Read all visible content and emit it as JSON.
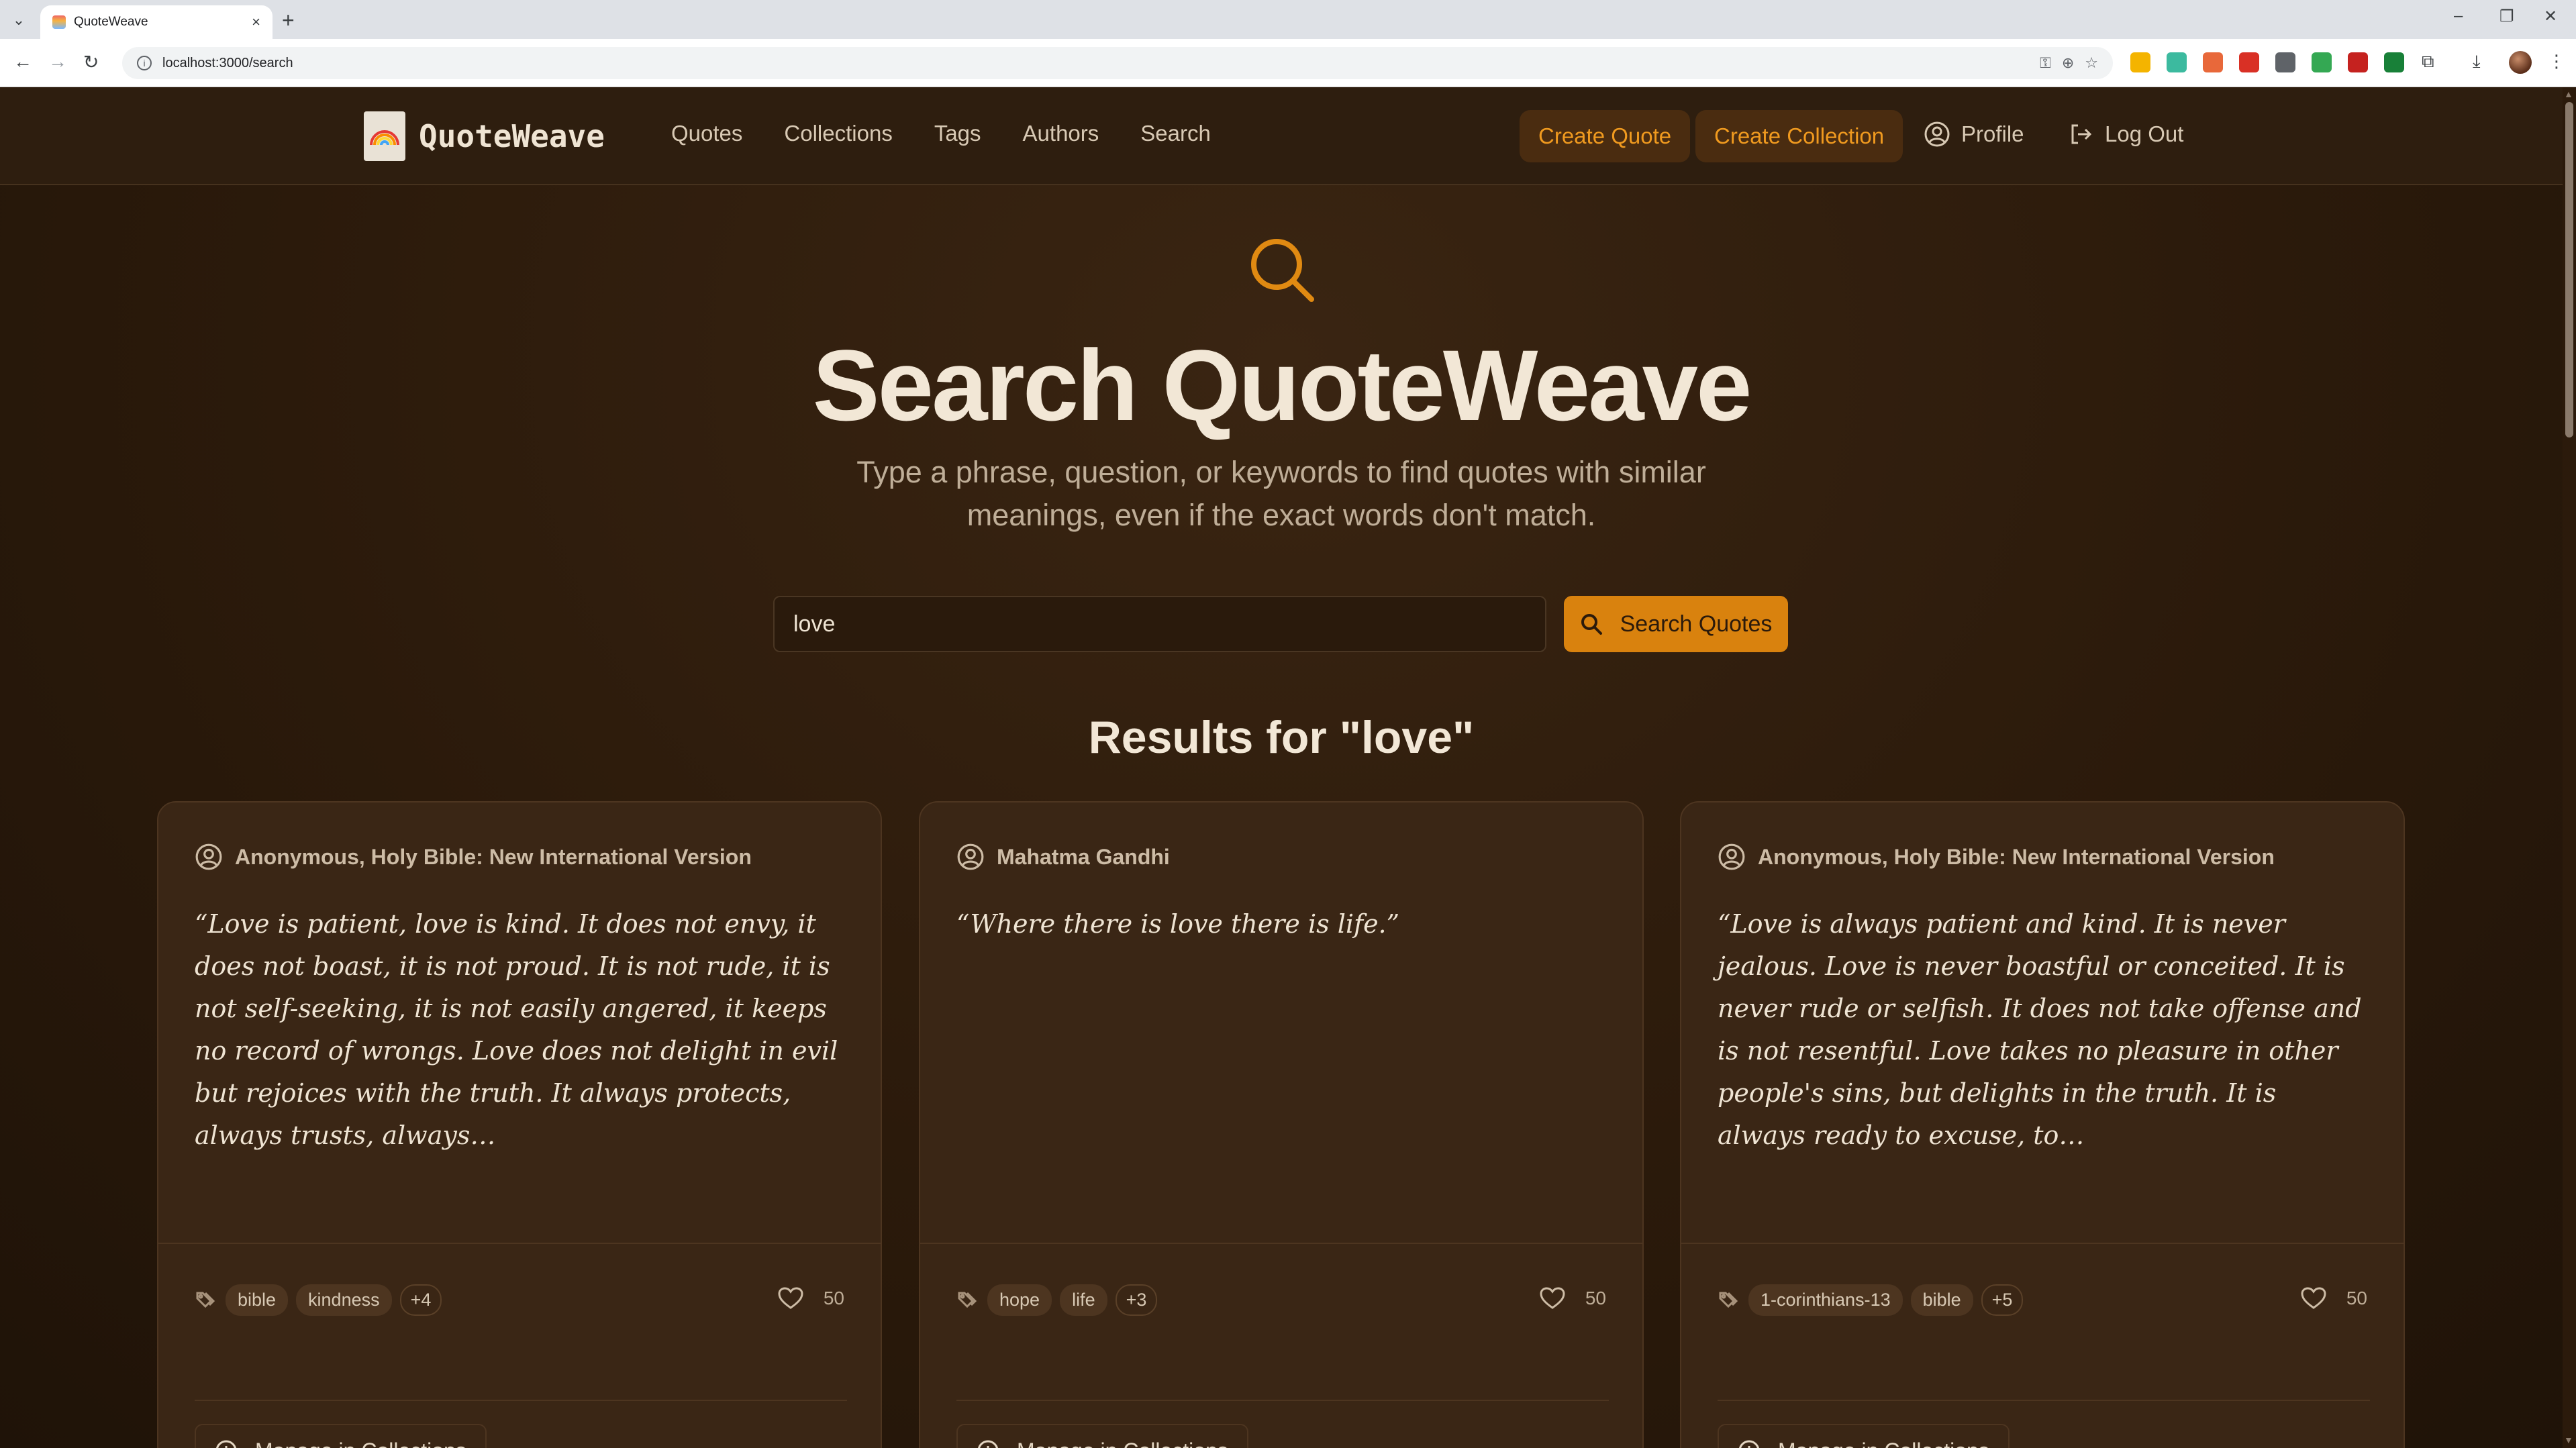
{
  "browser": {
    "tab_title": "QuoteWeave",
    "url": "localhost:3000/search"
  },
  "nav": {
    "brand": "QuoteWeave",
    "links": [
      "Quotes",
      "Collections",
      "Tags",
      "Authors",
      "Search"
    ],
    "create_quote": "Create Quote",
    "create_collection": "Create Collection",
    "profile": "Profile",
    "logout": "Log Out"
  },
  "hero": {
    "title": "Search QuoteWeave",
    "subtitle": "Type a phrase, question, or keywords to find quotes with similar meanings, even if the exact words don't match."
  },
  "search": {
    "value": "love",
    "button_label": "Search Quotes"
  },
  "results_title": "Results for \"love\"",
  "cards": [
    {
      "author": "Anonymous, Holy Bible: New International Version",
      "quote": "“Love is patient, love is kind. It does not envy, it does not boast, it is not proud. It is not rude, it is not self-seeking, it is not easily angered, it keeps no record of wrongs. Love does not delight in evil but rejoices with the truth. It always protects, always trusts, always…",
      "tags": [
        "bible",
        "kindness"
      ],
      "more": "+4",
      "likes": "50",
      "manage": "Manage in Collections"
    },
    {
      "author": "Mahatma Gandhi",
      "quote": "“Where there is love there is life.”",
      "tags": [
        "hope",
        "life"
      ],
      "more": "+3",
      "likes": "50",
      "manage": "Manage in Collections"
    },
    {
      "author": "Anonymous, Holy Bible: New International Version",
      "quote": "“Love is always patient and kind. It is never jealous. Love is never boastful or conceited. It is never rude or selfish. It does not take offense and is not resentful. Love takes no pleasure in other people's sins, but delights in the truth. It is always ready to excuse, to…",
      "tags": [
        "1-corinthians-13",
        "bible"
      ],
      "more": "+5",
      "likes": "50",
      "manage": "Manage in Collections"
    }
  ],
  "colors": {
    "accent": "#d9820e",
    "background": "#2b1a0b",
    "card": "#3a2615"
  }
}
